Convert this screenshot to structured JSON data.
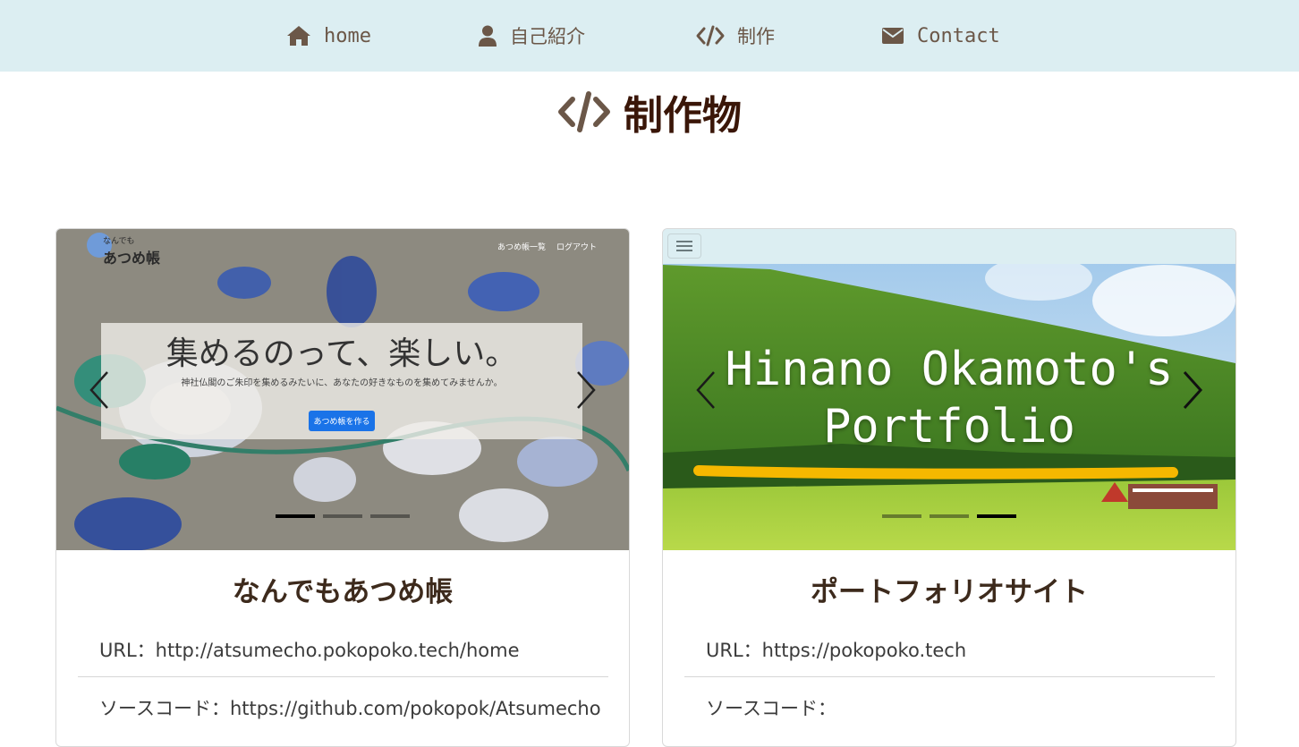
{
  "nav": {
    "items": [
      {
        "label": "home",
        "icon": "home-icon"
      },
      {
        "label": "自己紹介",
        "icon": "user-icon"
      },
      {
        "label": "制作",
        "icon": "code-icon"
      },
      {
        "label": "Contact",
        "icon": "envelope-icon"
      }
    ]
  },
  "page": {
    "title": "制作物",
    "title_icon": "code-icon"
  },
  "colors": {
    "nav_bg": "#dceef2",
    "nav_text": "#6b5748",
    "title": "#3a1608"
  },
  "cards": [
    {
      "title": "なんでもあつめ帳",
      "url_label": "URL：http://atsumecho.pokopoko.tech/home",
      "source_label": "ソースコード：https://github.com/pokopok/Atsumecho",
      "screenshot": {
        "logo_small": "なんでも",
        "logo_big": "あつめ帳",
        "nav_links": [
          "あつめ帳一覧",
          "ログアウト"
        ],
        "headline": "集めるのって、楽しい。",
        "subtext": "神社仏閣のご朱印を集めるみたいに、あなたの好きなものを集めてみませんか。",
        "button": "あつめ帳を作る"
      },
      "carousel": {
        "slides": 3,
        "active": 0
      }
    },
    {
      "title": "ポートフォリオサイト",
      "url_label": "URL：https://pokopoko.tech",
      "source_label": "ソースコード：",
      "screenshot": {
        "headline_line1": "Hinano Okamoto's",
        "headline_line2": "Portfolio"
      },
      "carousel": {
        "slides": 3,
        "active": 2
      }
    }
  ]
}
